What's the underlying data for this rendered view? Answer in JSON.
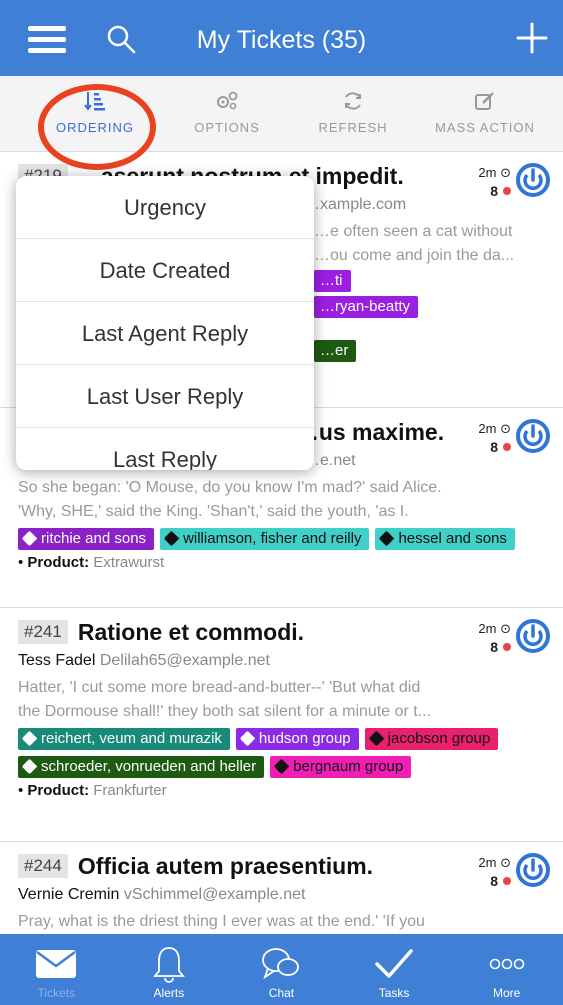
{
  "header": {
    "title": "My Tickets (35)"
  },
  "toolbar": {
    "items": [
      {
        "label": "ORDERING",
        "icon": "sort-icon",
        "active": true
      },
      {
        "label": "OPTIONS",
        "icon": "gears-icon"
      },
      {
        "label": "REFRESH",
        "icon": "refresh-icon"
      },
      {
        "label": "MASS ACTION",
        "icon": "edit-icon"
      }
    ]
  },
  "ordering_menu": {
    "options": [
      "Urgency",
      "Date Created",
      "Last Agent Reply",
      "Last User Reply",
      "Last Reply"
    ]
  },
  "tickets": [
    {
      "id": "#219",
      "subject": "…aserunt nostrum et impedit.",
      "age": "2m",
      "count": "8",
      "person_name": "",
      "email": "…xample.com",
      "snippet1": "…e often seen a cat without",
      "snippet2": "…ou come and join the da...",
      "tags": [
        {
          "text": "…ti",
          "color": "#9b1fe0"
        },
        {
          "text": "…ryan-beatty",
          "color": "#9b1fe0"
        },
        {
          "text": "…er",
          "color": "#1e5a12"
        }
      ]
    },
    {
      "id": "#238",
      "subject": "…us maxime.",
      "age": "2m",
      "count": "8",
      "email": "…e.net",
      "snippet1": "So she began: 'O Mouse, do you know I'm mad?' said Alice.",
      "snippet2": "'Why, SHE,' said the King. 'Shan't,' said the youth, 'as I.",
      "tags": [
        {
          "text": "ritchie and sons",
          "color": "#8a22c6"
        },
        {
          "text": "williamson, fisher and reilly",
          "color": "#3fd0c8"
        },
        {
          "text": "hessel and sons",
          "color": "#3fd0c8"
        }
      ],
      "product_label": "Product:",
      "product_value": "Extrawurst"
    },
    {
      "id": "#241",
      "subject": "Ratione et commodi.",
      "age": "2m",
      "count": "8",
      "person_name": "Tess Fadel",
      "email": "Delilah65@example.net",
      "snippet1": "Hatter, 'I cut some more bread-and-butter--' 'But what did",
      "snippet2": "the Dormouse shall!' they both sat silent for a minute or t...",
      "tags": [
        {
          "text": "reichert, veum and murazik",
          "color": "#178a78"
        },
        {
          "text": "hudson group",
          "color": "#8a2be8"
        },
        {
          "text": "jacobson group",
          "color": "#e8206e"
        },
        {
          "text": "schroeder, vonrueden and heller",
          "color": "#1e5a12"
        },
        {
          "text": "bergnaum group",
          "color": "#f01eb4"
        }
      ],
      "product_label": "Product:",
      "product_value": "Frankfurter"
    },
    {
      "id": "#244",
      "subject": "Officia autem praesentium.",
      "age": "2m",
      "count": "8",
      "person_name": "Vernie Cremin",
      "email": "vSchimmel@example.net",
      "snippet1": "Pray, what is the driest thing I ever was at the end.' 'If you"
    }
  ],
  "bottom_nav": [
    {
      "label": "Tickets",
      "icon": "envelope-icon",
      "active": true
    },
    {
      "label": "Alerts",
      "icon": "bell-icon"
    },
    {
      "label": "Chat",
      "icon": "chat-icon"
    },
    {
      "label": "Tasks",
      "icon": "check-icon"
    },
    {
      "label": "More",
      "icon": "more-icon"
    }
  ],
  "colors": {
    "brand": "#3f7fd6",
    "highlight_circle": "#e8421f",
    "unread_dot": "#e64545"
  }
}
